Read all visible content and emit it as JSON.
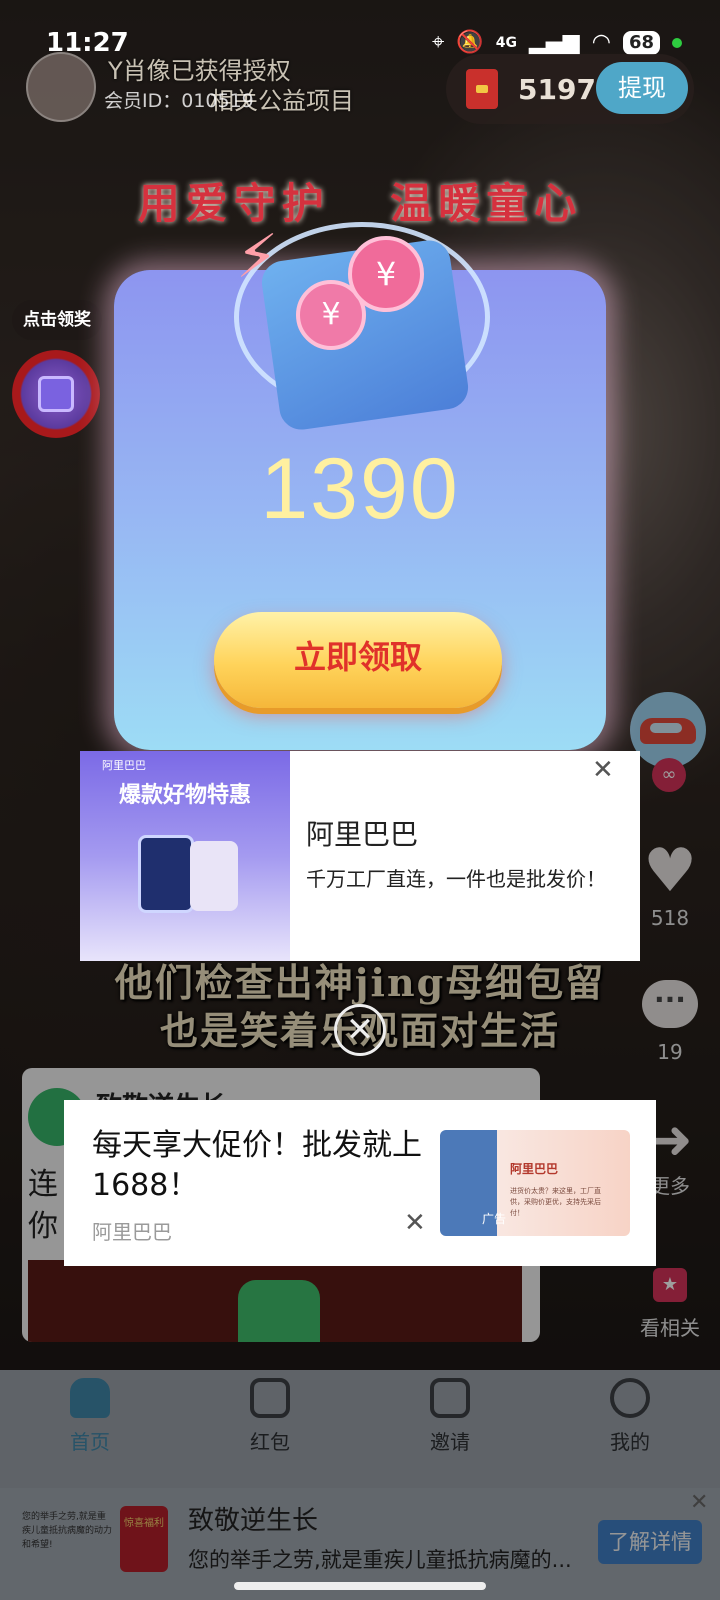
{
  "status_bar": {
    "time": "11:27",
    "network": "4G",
    "battery": "68"
  },
  "creator": {
    "caption_line1": "Y肖像已获得授权",
    "caption_line2": "相关公益项目",
    "member_id": "会员ID：010519"
  },
  "wallet": {
    "coins": "51977",
    "withdraw_label": "提现"
  },
  "reward_widget": {
    "tip": "点击领奖"
  },
  "popup": {
    "headline": "用爱守护 温暖童心",
    "amount": "1390",
    "claim_label": "立即领取",
    "coin_glyph": "¥"
  },
  "right_rail": {
    "likes": "518",
    "comments": "19",
    "share_label": "更多",
    "related_label": "看相关"
  },
  "subtitles": {
    "line1": "他们检查出神jing母细包留",
    "line2": "也是笑着乐观面对生活"
  },
  "ad_alibaba": {
    "image_brand": "阿里巴巴",
    "image_slogan": "爆款好物特惠",
    "title": "阿里巴巴",
    "description": "千万工厂直连，一件也是批发价！"
  },
  "ad_1688": {
    "title": "每天享大促价！批发就上1688！",
    "brand": "阿里巴巴",
    "image_title": "阿里巴巴",
    "image_text": "进货价太贵？来这里，工厂直供，采购价更优，支持先采后付！",
    "ad_tag": "广告"
  },
  "mini_card": {
    "title": "致敬逆生长",
    "line1": "连",
    "line2": "你"
  },
  "bottom_nav": {
    "items": [
      {
        "label": "首页",
        "icon": "home-icon",
        "active": true
      },
      {
        "label": "红包",
        "icon": "red-packet-icon",
        "active": false
      },
      {
        "label": "邀请",
        "icon": "invite-icon",
        "active": false
      },
      {
        "label": "我的",
        "icon": "profile-icon",
        "active": false
      }
    ]
  },
  "bottom_ad": {
    "small_text": "您的举手之劳,就是重疾儿童抵抗病魔的动力和希望!",
    "thumb_text": "惊喜福利",
    "title": "致敬逆生长",
    "subtitle": "您的举手之劳,就是重疾儿童抵抗病魔的...",
    "button_label": "了解详情"
  },
  "colors": {
    "accent_blue": "#3f86a8",
    "claim_text": "#e0322a",
    "amount_yellow": "#fff0a0"
  }
}
